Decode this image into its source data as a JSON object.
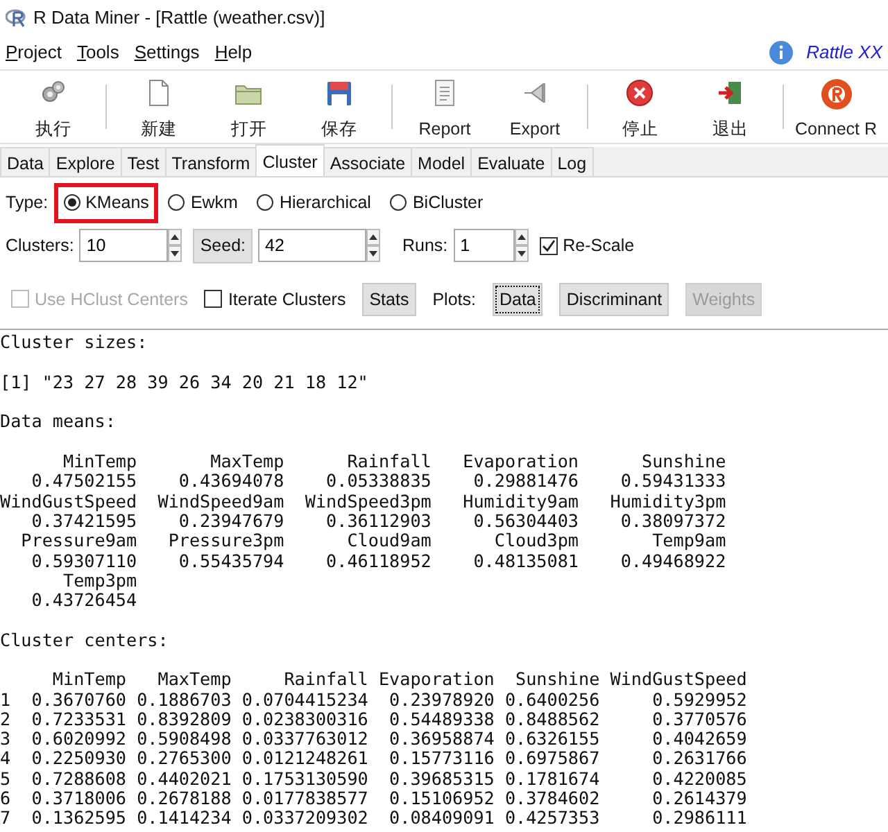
{
  "window": {
    "title": "R Data Miner - [Rattle (weather.csv)]"
  },
  "menu": [
    "Project",
    "Tools",
    "Settings",
    "Help"
  ],
  "version_label": "Rattle XX",
  "toolbar": [
    {
      "kind": "button",
      "label": "执行"
    },
    {
      "kind": "separator"
    },
    {
      "kind": "button",
      "label": "新建"
    },
    {
      "kind": "button",
      "label": "打开"
    },
    {
      "kind": "button",
      "label": "保存"
    },
    {
      "kind": "separator"
    },
    {
      "kind": "button",
      "label": "Report"
    },
    {
      "kind": "button",
      "label": "Export"
    },
    {
      "kind": "separator"
    },
    {
      "kind": "button",
      "label": "停止"
    },
    {
      "kind": "button",
      "label": "退出"
    },
    {
      "kind": "separator"
    },
    {
      "kind": "button",
      "label": "Connect R"
    }
  ],
  "tabs": [
    {
      "label": "Data",
      "selected": false
    },
    {
      "label": "Explore",
      "selected": false
    },
    {
      "label": "Test",
      "selected": false
    },
    {
      "label": "Transform",
      "selected": false
    },
    {
      "label": "Cluster",
      "selected": true
    },
    {
      "label": "Associate",
      "selected": false
    },
    {
      "label": "Model",
      "selected": false
    },
    {
      "label": "Evaluate",
      "selected": false
    },
    {
      "label": "Log",
      "selected": false
    }
  ],
  "type_row": {
    "label": "Type:",
    "options": [
      {
        "label": "KMeans",
        "selected": true,
        "highlighted": true
      },
      {
        "label": "Ewkm",
        "selected": false,
        "highlighted": false
      },
      {
        "label": "Hierarchical",
        "selected": false,
        "highlighted": false
      },
      {
        "label": "BiCluster",
        "selected": false,
        "highlighted": false
      }
    ]
  },
  "params": [
    {
      "kind": "spinner",
      "label": "Clusters:",
      "value": "10"
    },
    {
      "kind": "spinner-button",
      "label": "Seed:",
      "value": "42"
    },
    {
      "kind": "spinner",
      "label": "Runs:",
      "value": "1"
    },
    {
      "kind": "checkbox",
      "label": "Re-Scale",
      "checked": true
    }
  ],
  "options": [
    {
      "kind": "checkbox",
      "label": "Use HClust Centers",
      "checked": false,
      "disabled": true
    },
    {
      "kind": "checkbox",
      "label": "Iterate Clusters",
      "checked": false,
      "disabled": false
    },
    {
      "kind": "button",
      "label": "Stats",
      "disabled": false,
      "focused": false
    },
    {
      "kind": "label",
      "label": "Plots:"
    },
    {
      "kind": "button",
      "label": "Data",
      "disabled": false,
      "focused": true
    },
    {
      "kind": "button",
      "label": "Discriminant",
      "disabled": false,
      "focused": false
    },
    {
      "kind": "button",
      "label": "Weights",
      "disabled": true,
      "focused": false
    }
  ],
  "output": [
    [
      "Cluster sizes:"
    ],
    [
      "[1] \"23 27 28 39 26 34 20 21 18 12\""
    ],
    [
      "Data means:"
    ],
    [
      "      MinTemp       MaxTemp      Rainfall   Evaporation      Sunshine",
      "   0.47502155    0.43694078    0.05338835    0.29881476    0.59431333",
      "WindGustSpeed  WindSpeed9am  WindSpeed3pm   Humidity9am   Humidity3pm",
      "   0.37421595    0.23947679    0.36112903    0.56304403    0.38097372",
      "  Pressure9am   Pressure3pm      Cloud9am      Cloud3pm       Temp9am",
      "   0.59307110    0.55435794    0.46118952    0.48135081    0.49468922",
      "      Temp3pm",
      "   0.43726454"
    ],
    [
      "Cluster centers:"
    ],
    [
      "     MinTemp   MaxTemp     Rainfall Evaporation  Sunshine WindGustSpeed",
      "1  0.3670760 0.1886703 0.0704415234  0.23978920 0.6400256     0.5929952",
      "2  0.7233531 0.8392809 0.0238300316  0.54489338 0.8488562     0.3770576",
      "3  0.6020992 0.5908498 0.0337763012  0.36958874 0.6326155     0.4042659",
      "4  0.2250930 0.2765300 0.0121248261  0.15773116 0.6975867     0.2631766",
      "5  0.7288608 0.4402021 0.1753130590  0.39685315 0.1781674     0.4220085",
      "6  0.3718006 0.2678188 0.0177838577  0.15106952 0.3784602     0.2614379",
      "7  0.1362595 0.1414234 0.0337209302  0.08409091 0.4257353     0.2986111"
    ]
  ]
}
